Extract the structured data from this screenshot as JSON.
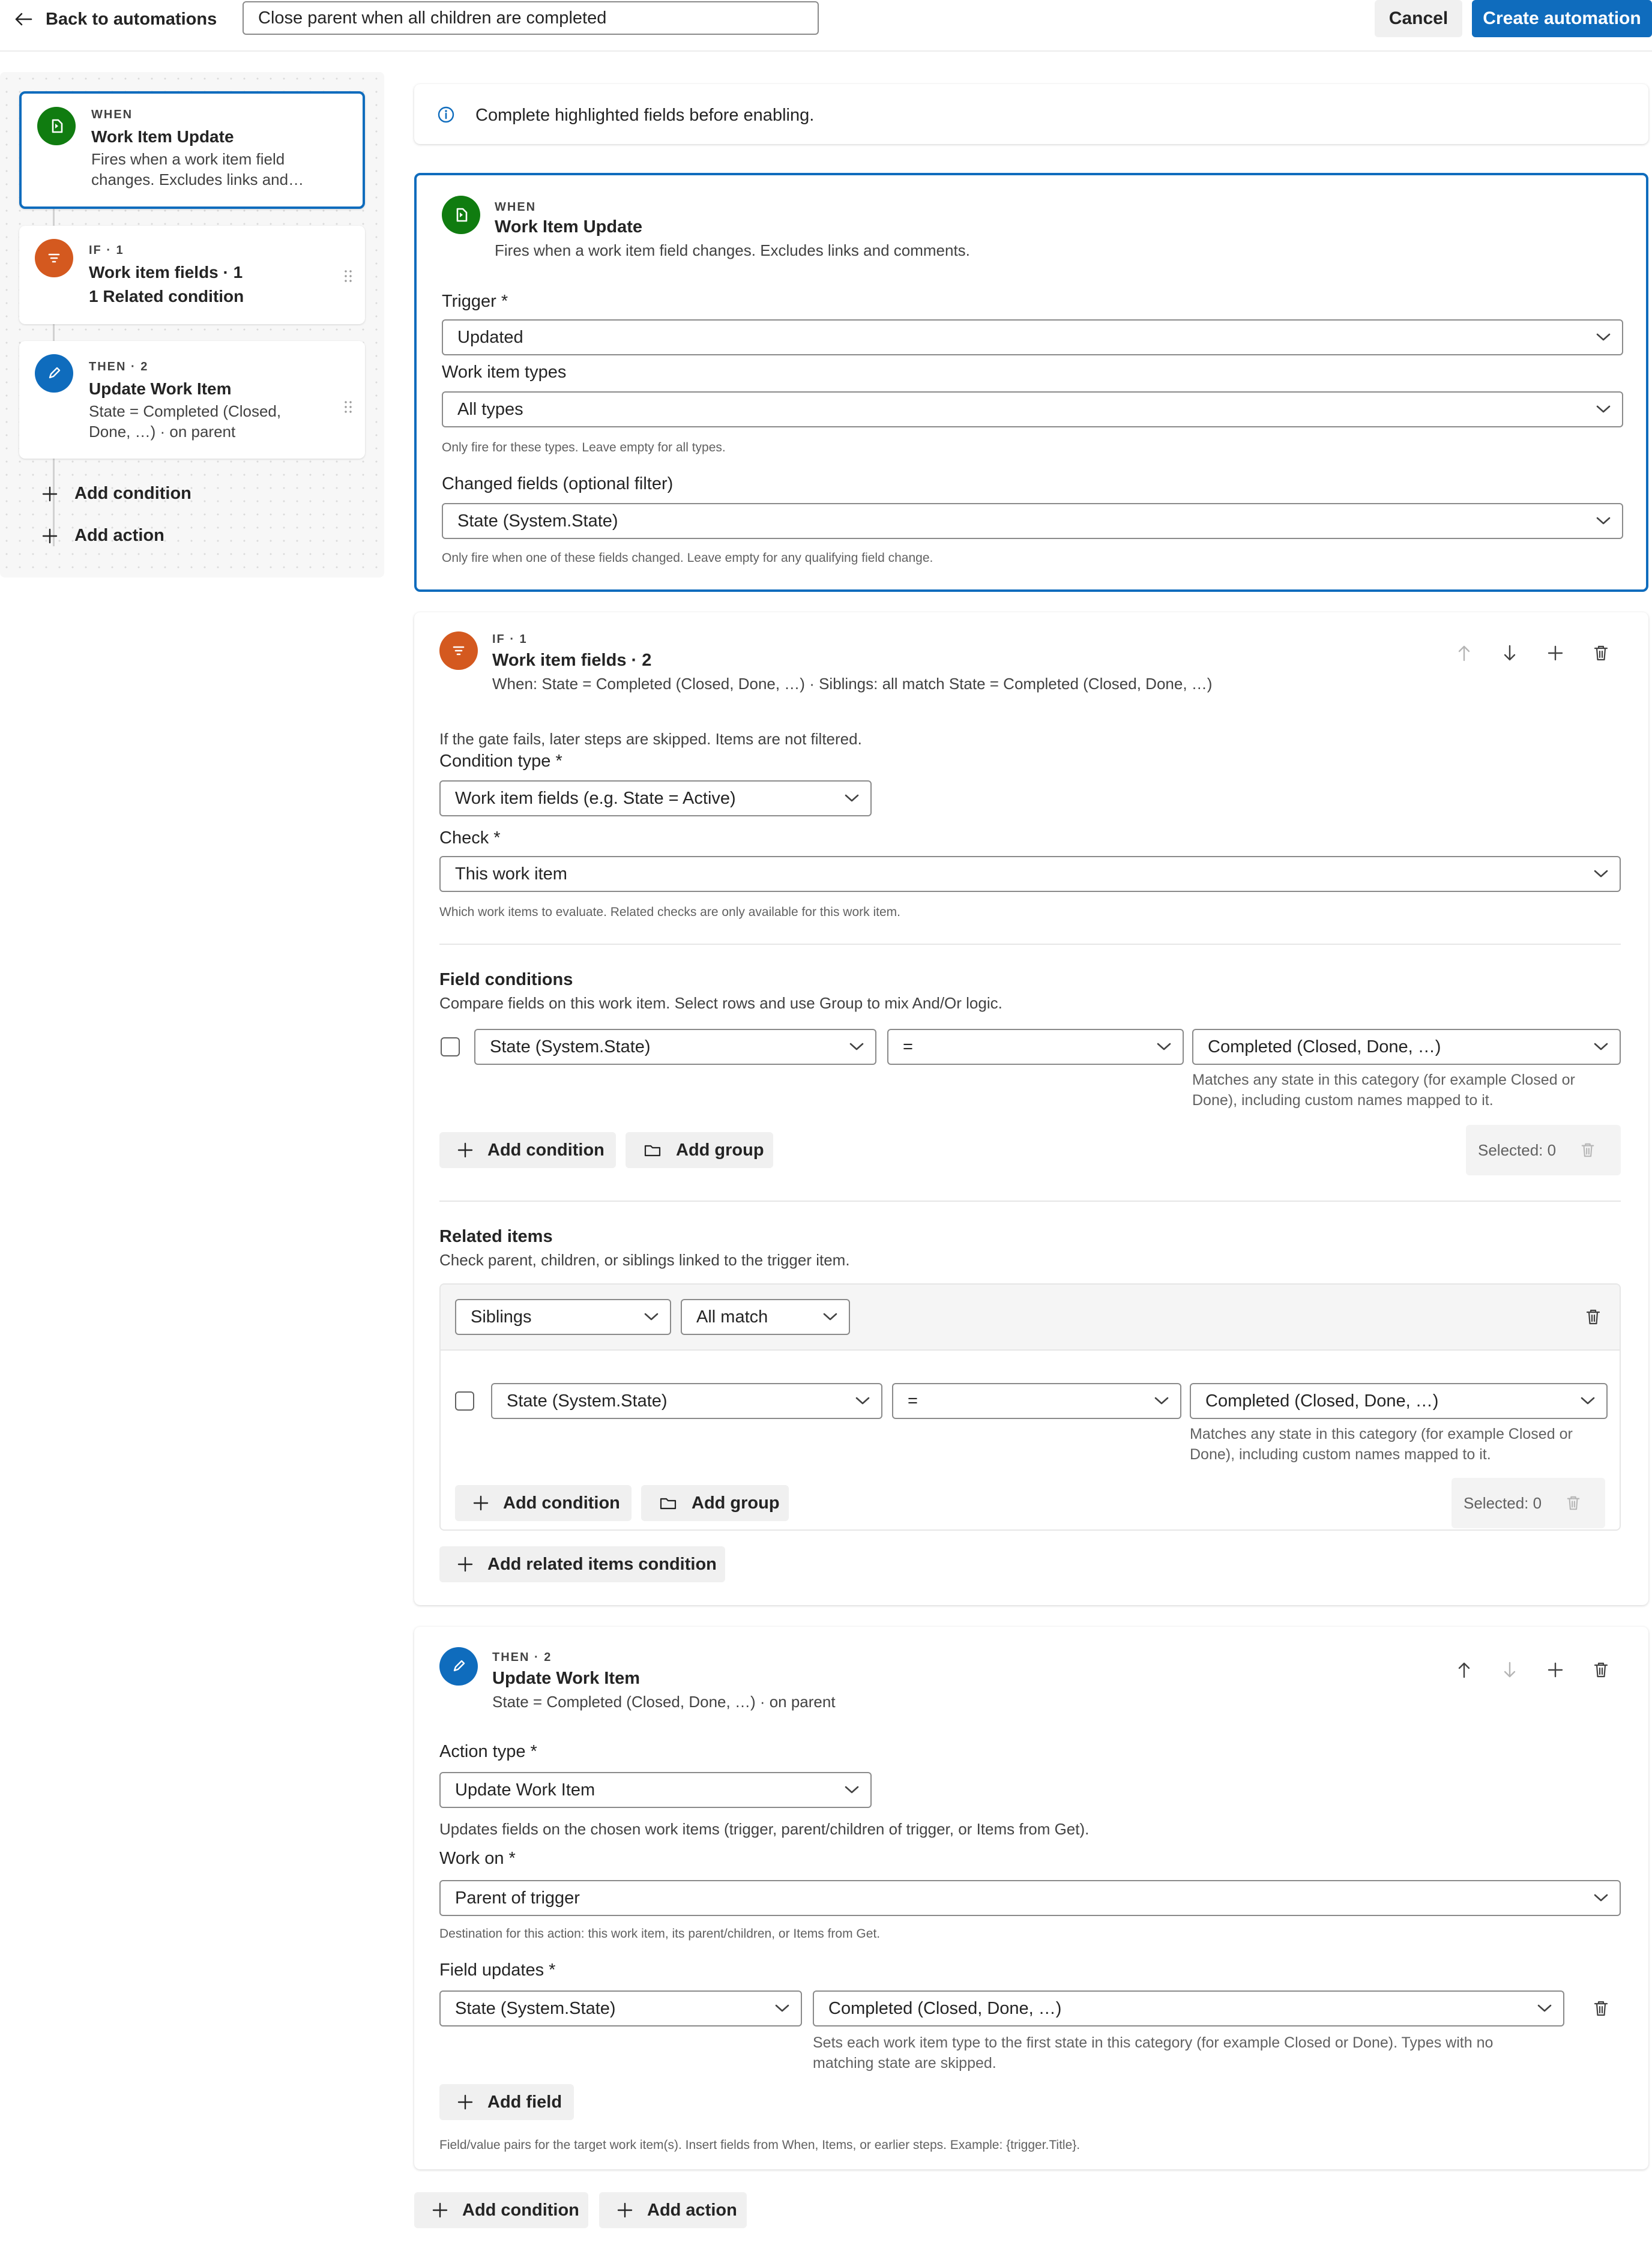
{
  "topbar": {
    "back_label": "Back to automations",
    "name_value": "Close parent when all children are completed",
    "cancel_label": "Cancel",
    "create_label": "Create automation"
  },
  "sidebar": {
    "when": {
      "kicker": "WHEN",
      "title": "Work Item Update",
      "desc_line1": "Fires when a work item field",
      "desc_line2": "changes. Excludes links and…"
    },
    "if": {
      "kicker": "IF · 1",
      "title": "Work item fields · 1",
      "subtitle": "1 Related condition"
    },
    "then": {
      "kicker": "THEN · 2",
      "title": "Update Work Item",
      "desc_line1": "State = Completed (Closed,",
      "desc_line2": "Done, …) · on parent"
    },
    "add_condition": "Add condition",
    "add_action": "Add action"
  },
  "banner": {
    "text": "Complete highlighted fields before enabling."
  },
  "when_card": {
    "kicker": "WHEN",
    "title": "Work Item Update",
    "desc": "Fires when a work item field changes. Excludes links and comments.",
    "trigger_label": "Trigger *",
    "trigger_value": "Updated",
    "types_label": "Work item types",
    "types_value": "All types",
    "types_help": "Only fire for these types. Leave empty for all types.",
    "changed_label": "Changed fields (optional filter)",
    "changed_value": "State (System.State)",
    "changed_help": "Only fire when one of these fields changed. Leave empty for any qualifying field change."
  },
  "if_card": {
    "kicker": "IF · 1",
    "title": "Work item fields · 2",
    "desc": "When: State = Completed (Closed, Done, …) · Siblings: all match State = Completed (Closed, Done, …)",
    "gate_note": "If the gate fails, later steps are skipped. Items are not filtered.",
    "condtype_label": "Condition type *",
    "condtype_value": "Work item fields (e.g. State = Active)",
    "check_label": "Check *",
    "check_value": "This work item",
    "check_help": "Which work items to evaluate. Related checks are only available for this work item.",
    "field_conditions": {
      "title": "Field conditions",
      "desc": "Compare fields on this work item. Select rows and use Group to mix And/Or logic.",
      "field": "State (System.State)",
      "operator": "=",
      "value": "Completed (Closed, Done, …)",
      "help_line1": "Matches any state in this category (for example Closed or",
      "help_line2": "Done), including custom names mapped to it.",
      "add_condition": "Add condition",
      "add_group": "Add group",
      "selected": "Selected: 0"
    },
    "related_items": {
      "title": "Related items",
      "desc": "Check parent, children, or siblings linked to the trigger item.",
      "relation": "Siblings",
      "match": "All match",
      "field": "State (System.State)",
      "operator": "=",
      "value": "Completed (Closed, Done, …)",
      "help_line1": "Matches any state in this category (for example Closed or",
      "help_line2": "Done), including custom names mapped to it.",
      "add_condition": "Add condition",
      "add_group": "Add group",
      "selected": "Selected: 0",
      "add_related": "Add related items condition"
    }
  },
  "then_card": {
    "kicker": "THEN · 2",
    "title": "Update Work Item",
    "desc": "State = Completed (Closed, Done, …) · on parent",
    "actiontype_label": "Action type *",
    "actiontype_value": "Update Work Item",
    "actiontype_help": "Updates fields on the chosen work items (trigger, parent/children of trigger, or Items from Get).",
    "workon_label": "Work on *",
    "workon_value": "Parent of trigger",
    "workon_help": "Destination for this action: this work item, its parent/children, or Items from Get.",
    "updates_label": "Field updates *",
    "update_field": "State (System.State)",
    "update_value": "Completed (Closed, Done, …)",
    "update_help_line1": "Sets each work item type to the first state in this category (for example Closed or Done). Types with no",
    "update_help_line2": "matching state are skipped.",
    "add_field": "Add field",
    "fields_help": "Field/value pairs for the target work item(s). Insert fields from When, Items, or earlier steps. Example: {trigger.Title}."
  },
  "bottom": {
    "add_condition": "Add condition",
    "add_action": "Add action"
  },
  "colors": {
    "accent": "#0f6cbd",
    "when_green": "#107c10",
    "if_orange": "#d4591f",
    "then_blue": "#0f6cbd"
  },
  "icons": [
    "arrow-left-icon",
    "info-icon",
    "trigger-icon",
    "filter-icon",
    "pencil-icon",
    "chevron-down-icon",
    "plus-icon",
    "folder-icon",
    "trash-icon",
    "arrow-up-icon",
    "arrow-down-icon",
    "drag-handle-icon"
  ]
}
